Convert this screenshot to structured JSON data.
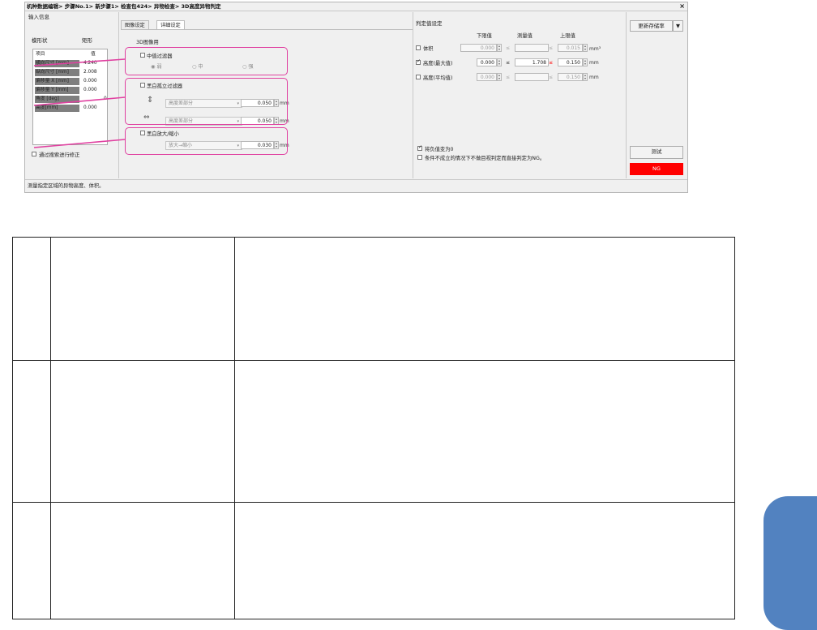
{
  "dialog": {
    "title": "机种数据编辑> 步骤No.1> 新步骤1> 检查包424> 异物检查> 3D高度异物判定",
    "close": "×"
  },
  "input_info": {
    "title": "输入信息",
    "shape_label": "模形状",
    "shape_value": "矩形",
    "table_header": {
      "item": "项目",
      "value": "值"
    },
    "rows": [
      {
        "name": "横向尺寸 [mm]",
        "value": "4.240"
      },
      {
        "name": "纵向尺寸 [mm]",
        "value": "2.008"
      },
      {
        "name": "偏移量 X [mm]",
        "value": "0.000"
      },
      {
        "name": "偏移量 Y [mm]",
        "value": "0.000"
      },
      {
        "name": "角度 [deg]",
        "value": "0"
      },
      {
        "name": "高度[mm]",
        "value": "0.000"
      }
    ],
    "correction_checkbox": "通过搜索进行修正"
  },
  "tabs": [
    "图像设定",
    "详细设定"
  ],
  "image_3d": {
    "title": "3D图像用",
    "median_filter": {
      "label": "中值过滤器",
      "options": [
        "弱",
        "中",
        "强"
      ],
      "selected": "弱"
    },
    "bw_filter": {
      "label": "黑白孤立过滤器",
      "rows": [
        {
          "icon": "vertical-arrow-icon",
          "select": "高度差部分",
          "value": "0.050",
          "unit": "mm"
        },
        {
          "icon": "horizontal-arrow-icon",
          "select": "高度差部分",
          "value": "0.050",
          "unit": "mm"
        }
      ]
    },
    "bw_scale": {
      "label": "黑白放大/缩小",
      "select": "放大→缩小",
      "value": "0.030",
      "unit": "mm"
    }
  },
  "judgement": {
    "title": "判定值设定",
    "headers": {
      "lower": "下限值",
      "measured": "测量值",
      "upper": "上限值"
    },
    "rows": [
      {
        "label": "体积",
        "checked": false,
        "lower": "0.000",
        "measured": "",
        "upper": "0.015",
        "unit": "mm³"
      },
      {
        "label": "高度(最大值)",
        "checked": true,
        "lower": "0.000",
        "measured": "1.708",
        "upper": "0.150",
        "unit": "mm"
      },
      {
        "label": "高度(平均值)",
        "checked": false,
        "lower": "0.000",
        "measured": "",
        "upper": "0.150",
        "unit": "mm"
      }
    ],
    "le_symbol": "≤",
    "negative_zero": "将负值变为0",
    "ng_condition": "条件不成立的情况下不做目视判定而直接判定为NG。"
  },
  "actions": {
    "update_save": "更新存储率",
    "test": "测试",
    "result": "NG"
  },
  "status": "测量指定区域的异物高度、体积。",
  "colors": {
    "callout": "#e040a0",
    "ng": "#ff0000",
    "side_tab": "#5282c0"
  }
}
